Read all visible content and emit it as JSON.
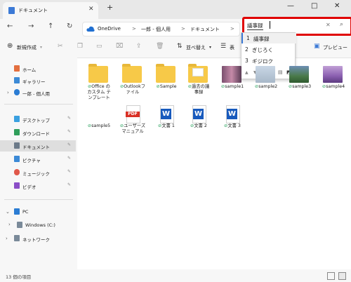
{
  "titlebar": {
    "tab_title": "ドキュメント",
    "close_tab": "✕",
    "new_tab": "+",
    "minimize": "—",
    "maximize": "□",
    "close_window": "✕"
  },
  "nav": {
    "back": "←",
    "forward": "→",
    "up": "↑",
    "refresh": "↻",
    "breadcrumbs": [
      "OneDrive",
      "一郎 - 個人用",
      "ドキュメント"
    ],
    "separator": ">"
  },
  "search": {
    "value": "議事録",
    "clear": "✕",
    "icon": "⌕"
  },
  "ime": {
    "candidates": [
      {
        "num": "1",
        "text": "議事録"
      },
      {
        "num": "2",
        "text": "ぎじろく"
      },
      {
        "num": "3",
        "text": "ギジロク"
      }
    ]
  },
  "toolbar": {
    "new_label": "新規作成",
    "sort_label": "並べ替え",
    "view_label": "表",
    "preview_label": "プレビュー"
  },
  "sidebar": {
    "items": [
      {
        "label": "ホーム",
        "color": "#e36f3f"
      },
      {
        "label": "ギャラリー",
        "color": "#3c8ad6"
      },
      {
        "label": "一郎 - 個人用",
        "color": "#2b7cd3"
      },
      {
        "label": "デスクトップ",
        "color": "#3aa0e0"
      },
      {
        "label": "ダウンロード",
        "color": "#2f9e5a"
      },
      {
        "label": "ドキュメント",
        "color": "#6c7a89"
      },
      {
        "label": "ピクチャ",
        "color": "#3c8ad6"
      },
      {
        "label": "ミュージック",
        "color": "#e0584a"
      },
      {
        "label": "ビデオ",
        "color": "#8b4fc7"
      },
      {
        "label": "PC",
        "color": "#2b7cd3"
      },
      {
        "label": "Windows (C:)",
        "color": "#7a8a99"
      },
      {
        "label": "ネットワーク",
        "color": "#7a8a99"
      }
    ]
  },
  "files": [
    {
      "name": "Office の\nカスタム テ\nンプレート",
      "type": "folder"
    },
    {
      "name": "Outlookフ\nァイル",
      "type": "folder"
    },
    {
      "name": "Sample",
      "type": "folder"
    },
    {
      "name": "過去の議\n事録",
      "type": "folder-doc"
    },
    {
      "name": "sample1",
      "type": "photo"
    },
    {
      "name": "sample2",
      "type": "photo"
    },
    {
      "name": "sample3",
      "type": "photo"
    },
    {
      "name": "sample4",
      "type": "photo"
    },
    {
      "name": "sample5",
      "type": "photo"
    },
    {
      "name": "ユーザーズ\nマニュアル",
      "type": "pdf"
    },
    {
      "name": "文書 1",
      "type": "word"
    },
    {
      "name": "文書 2",
      "type": "word"
    },
    {
      "name": "文書 3",
      "type": "word"
    }
  ],
  "status": {
    "count_text": "13 個の項目"
  },
  "icons": {
    "pin": "📌",
    "check": "⊘",
    "pdf": "PDF",
    "word": "W"
  }
}
